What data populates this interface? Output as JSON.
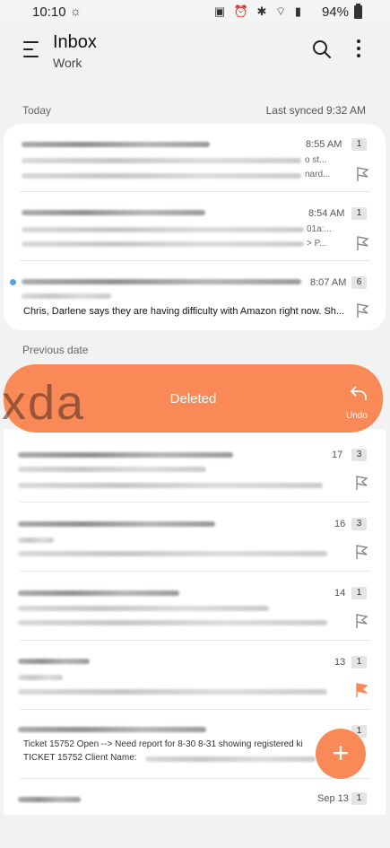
{
  "status": {
    "time": "10:10",
    "battery": "94%"
  },
  "header": {
    "title": "Inbox",
    "subtitle": "Work"
  },
  "sections": {
    "today": "Today",
    "previous": "Previous date",
    "last_synced": "Last synced  9:32 AM"
  },
  "today_messages": [
    {
      "time": "8:55 AM",
      "count": "1",
      "tail1": "o st...",
      "tail2": "nard..."
    },
    {
      "time": "8:54 AM",
      "count": "1",
      "tail1": "01a:...",
      "tail2": "> P..."
    },
    {
      "time": "8:07 AM",
      "count": "6",
      "preview": "Chris,  Darlene says they are having difficulty with Amazon right now. Sh..."
    }
  ],
  "swipe": {
    "label": "Deleted",
    "undo": "Undo"
  },
  "watermark": "xda",
  "previous_messages": [
    {
      "time": "17",
      "count": "3"
    },
    {
      "time": "16",
      "count": "3"
    },
    {
      "time": "14",
      "count": "1"
    },
    {
      "time": "13",
      "count": "1"
    },
    {
      "count": "1",
      "preview1": "Ticket 15752 Open --> Need report for 8-30 8-31 showing registered ki",
      "preview2": "TICKET 15752 Client Name: "
    },
    {
      "time": "Sep 13",
      "count": "1"
    }
  ],
  "colors": {
    "accent": "#f98a58",
    "unread": "#5aa3e0"
  }
}
